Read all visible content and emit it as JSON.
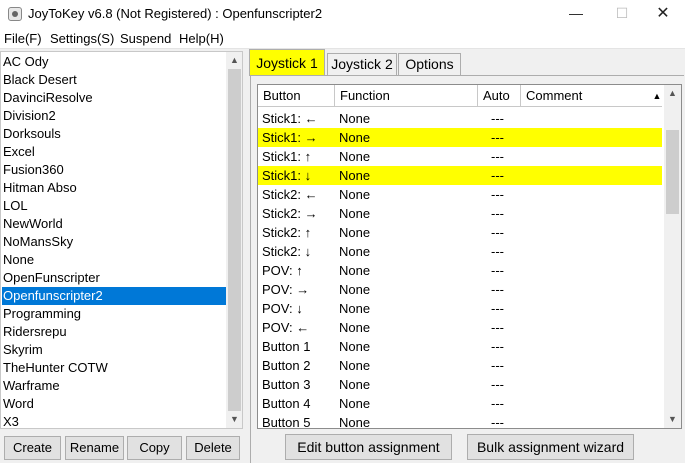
{
  "window": {
    "title": "JoyToKey v6.8 (Not Registered) : Openfunscripter2",
    "minimize": "—",
    "maximize": "☐",
    "close": "✕"
  },
  "menu": [
    "File(F)",
    "Settings(S)",
    "Suspend",
    "Help(H)"
  ],
  "profiles": {
    "items": [
      "AC Ody",
      "Black Desert",
      "DavinciResolve",
      "Division2",
      "Dorksouls",
      "Excel",
      "Fusion360",
      "Hitman Abso",
      "LOL",
      "NewWorld",
      "NoMansSky",
      "None",
      "OpenFunscripter",
      "Openfunscripter2",
      "Programming",
      "Ridersrepu",
      "Skyrim",
      "TheHunter COTW",
      "Warframe",
      "Word",
      "X3"
    ],
    "selected_index": 13
  },
  "profile_buttons": {
    "create": "Create",
    "rename": "Rename",
    "copy": "Copy",
    "delete": "Delete"
  },
  "tabs": [
    "Joystick 1",
    "Joystick 2",
    "Options"
  ],
  "grid": {
    "columns": [
      "Button",
      "Function",
      "Auto",
      "Comment"
    ],
    "rows": [
      {
        "button": "Stick1: ←",
        "function": "None",
        "auto": "---",
        "highlight": false
      },
      {
        "button": "Stick1: →",
        "function": "None",
        "auto": "---",
        "highlight": true
      },
      {
        "button": "Stick1: ↑",
        "function": "None",
        "auto": "---",
        "highlight": false
      },
      {
        "button": "Stick1: ↓",
        "function": "None",
        "auto": "---",
        "highlight": true
      },
      {
        "button": "Stick2: ←",
        "function": "None",
        "auto": "---",
        "highlight": false
      },
      {
        "button": "Stick2: →",
        "function": "None",
        "auto": "---",
        "highlight": false
      },
      {
        "button": "Stick2: ↑",
        "function": "None",
        "auto": "---",
        "highlight": false
      },
      {
        "button": "Stick2: ↓",
        "function": "None",
        "auto": "---",
        "highlight": false
      },
      {
        "button": "POV: ↑",
        "function": "None",
        "auto": "---",
        "highlight": false
      },
      {
        "button": "POV: →",
        "function": "None",
        "auto": "---",
        "highlight": false
      },
      {
        "button": "POV: ↓",
        "function": "None",
        "auto": "---",
        "highlight": false
      },
      {
        "button": "POV: ←",
        "function": "None",
        "auto": "---",
        "highlight": false
      },
      {
        "button": "Button 1",
        "function": "None",
        "auto": "---",
        "highlight": false
      },
      {
        "button": "Button 2",
        "function": "None",
        "auto": "---",
        "highlight": false
      },
      {
        "button": "Button 3",
        "function": "None",
        "auto": "---",
        "highlight": false
      },
      {
        "button": "Button 4",
        "function": "None",
        "auto": "---",
        "highlight": false
      },
      {
        "button": "Button 5",
        "function": "None",
        "auto": "---",
        "highlight": false
      }
    ]
  },
  "actions": {
    "edit": "Edit button assignment",
    "bulk": "Bulk assignment wizard"
  },
  "colors": {
    "highlight": "#ffff00",
    "selection": "#0078d7"
  },
  "icons": {
    "up": "▲",
    "down": "▼",
    "sort": "▲"
  }
}
